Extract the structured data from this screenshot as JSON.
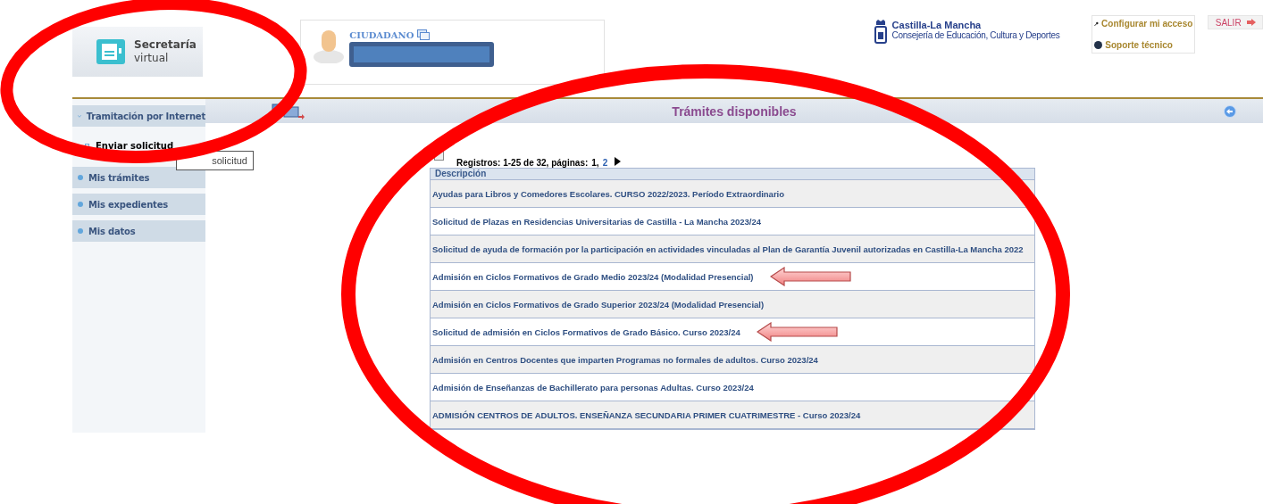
{
  "header": {
    "logo": {
      "title": "Secretaría",
      "subtitle": "virtual"
    },
    "user": {
      "role": "CIUDADANO"
    },
    "org": {
      "name": "Castilla-La Mancha",
      "department": "Consejería de Educación, Cultura y Deportes"
    },
    "links": [
      {
        "kind": "settings",
        "label": "Configurar mi acceso"
      },
      {
        "kind": "help",
        "label": "Soporte técnico"
      }
    ],
    "exit": "SALIR"
  },
  "sidebar": {
    "items": [
      {
        "label": "Tramitación por Internet",
        "expanded": true,
        "children": [
          {
            "label": "Enviar solicitud",
            "selected": true
          }
        ]
      },
      {
        "label": "Mis trámites",
        "expanded": false
      },
      {
        "label": "Mis expedientes",
        "expanded": false
      },
      {
        "label": "Mis datos",
        "expanded": false
      }
    ]
  },
  "tooltip": "solicitud",
  "title": "Trámites disponibles",
  "pager": {
    "summary": "Registros: 1-25 de 32, páginas:",
    "pages": [
      {
        "label": "1,",
        "selected": true
      },
      {
        "label": "2",
        "selected": false
      }
    ]
  },
  "table": {
    "columns": [
      "Descripción"
    ],
    "rows": [
      {
        "text": "Ayudas para Libros y Comedores Escolares. CURSO 2022/2023. Período Extraordinario",
        "marked": false
      },
      {
        "text": "Solicitud de Plazas en Residencias Universitarias de Castilla - La Mancha 2023/24",
        "marked": false
      },
      {
        "text": "Solicitud de ayuda de formación por la participación en actividades vinculadas al Plan de Garantía Juvenil autorizadas en Castilla-La Mancha 2022",
        "marked": false
      },
      {
        "text": "Admisión en Ciclos Formativos de Grado Medio 2023/24 (Modalidad Presencial)",
        "marked": true
      },
      {
        "text": "Admisión en Ciclos Formativos de Grado Superior 2023/24 (Modalidad Presencial)",
        "marked": false
      },
      {
        "text": "Solicitud de admisión en Ciclos Formativos de Grado Básico. Curso 2023/24",
        "marked": true
      },
      {
        "text": "Admisión en Centros Docentes que imparten Programas no formales de adultos. Curso 2023/24",
        "marked": false
      },
      {
        "text": "Admisión de Enseñanzas de Bachillerato para personas Adultas. Curso 2023/24",
        "marked": false
      },
      {
        "text": "ADMISIÓN CENTROS DE ADULTOS. ENSEÑANZA SECUNDARIA PRIMER CUATRIMESTRE - Curso 2023/24",
        "marked": false
      }
    ]
  }
}
